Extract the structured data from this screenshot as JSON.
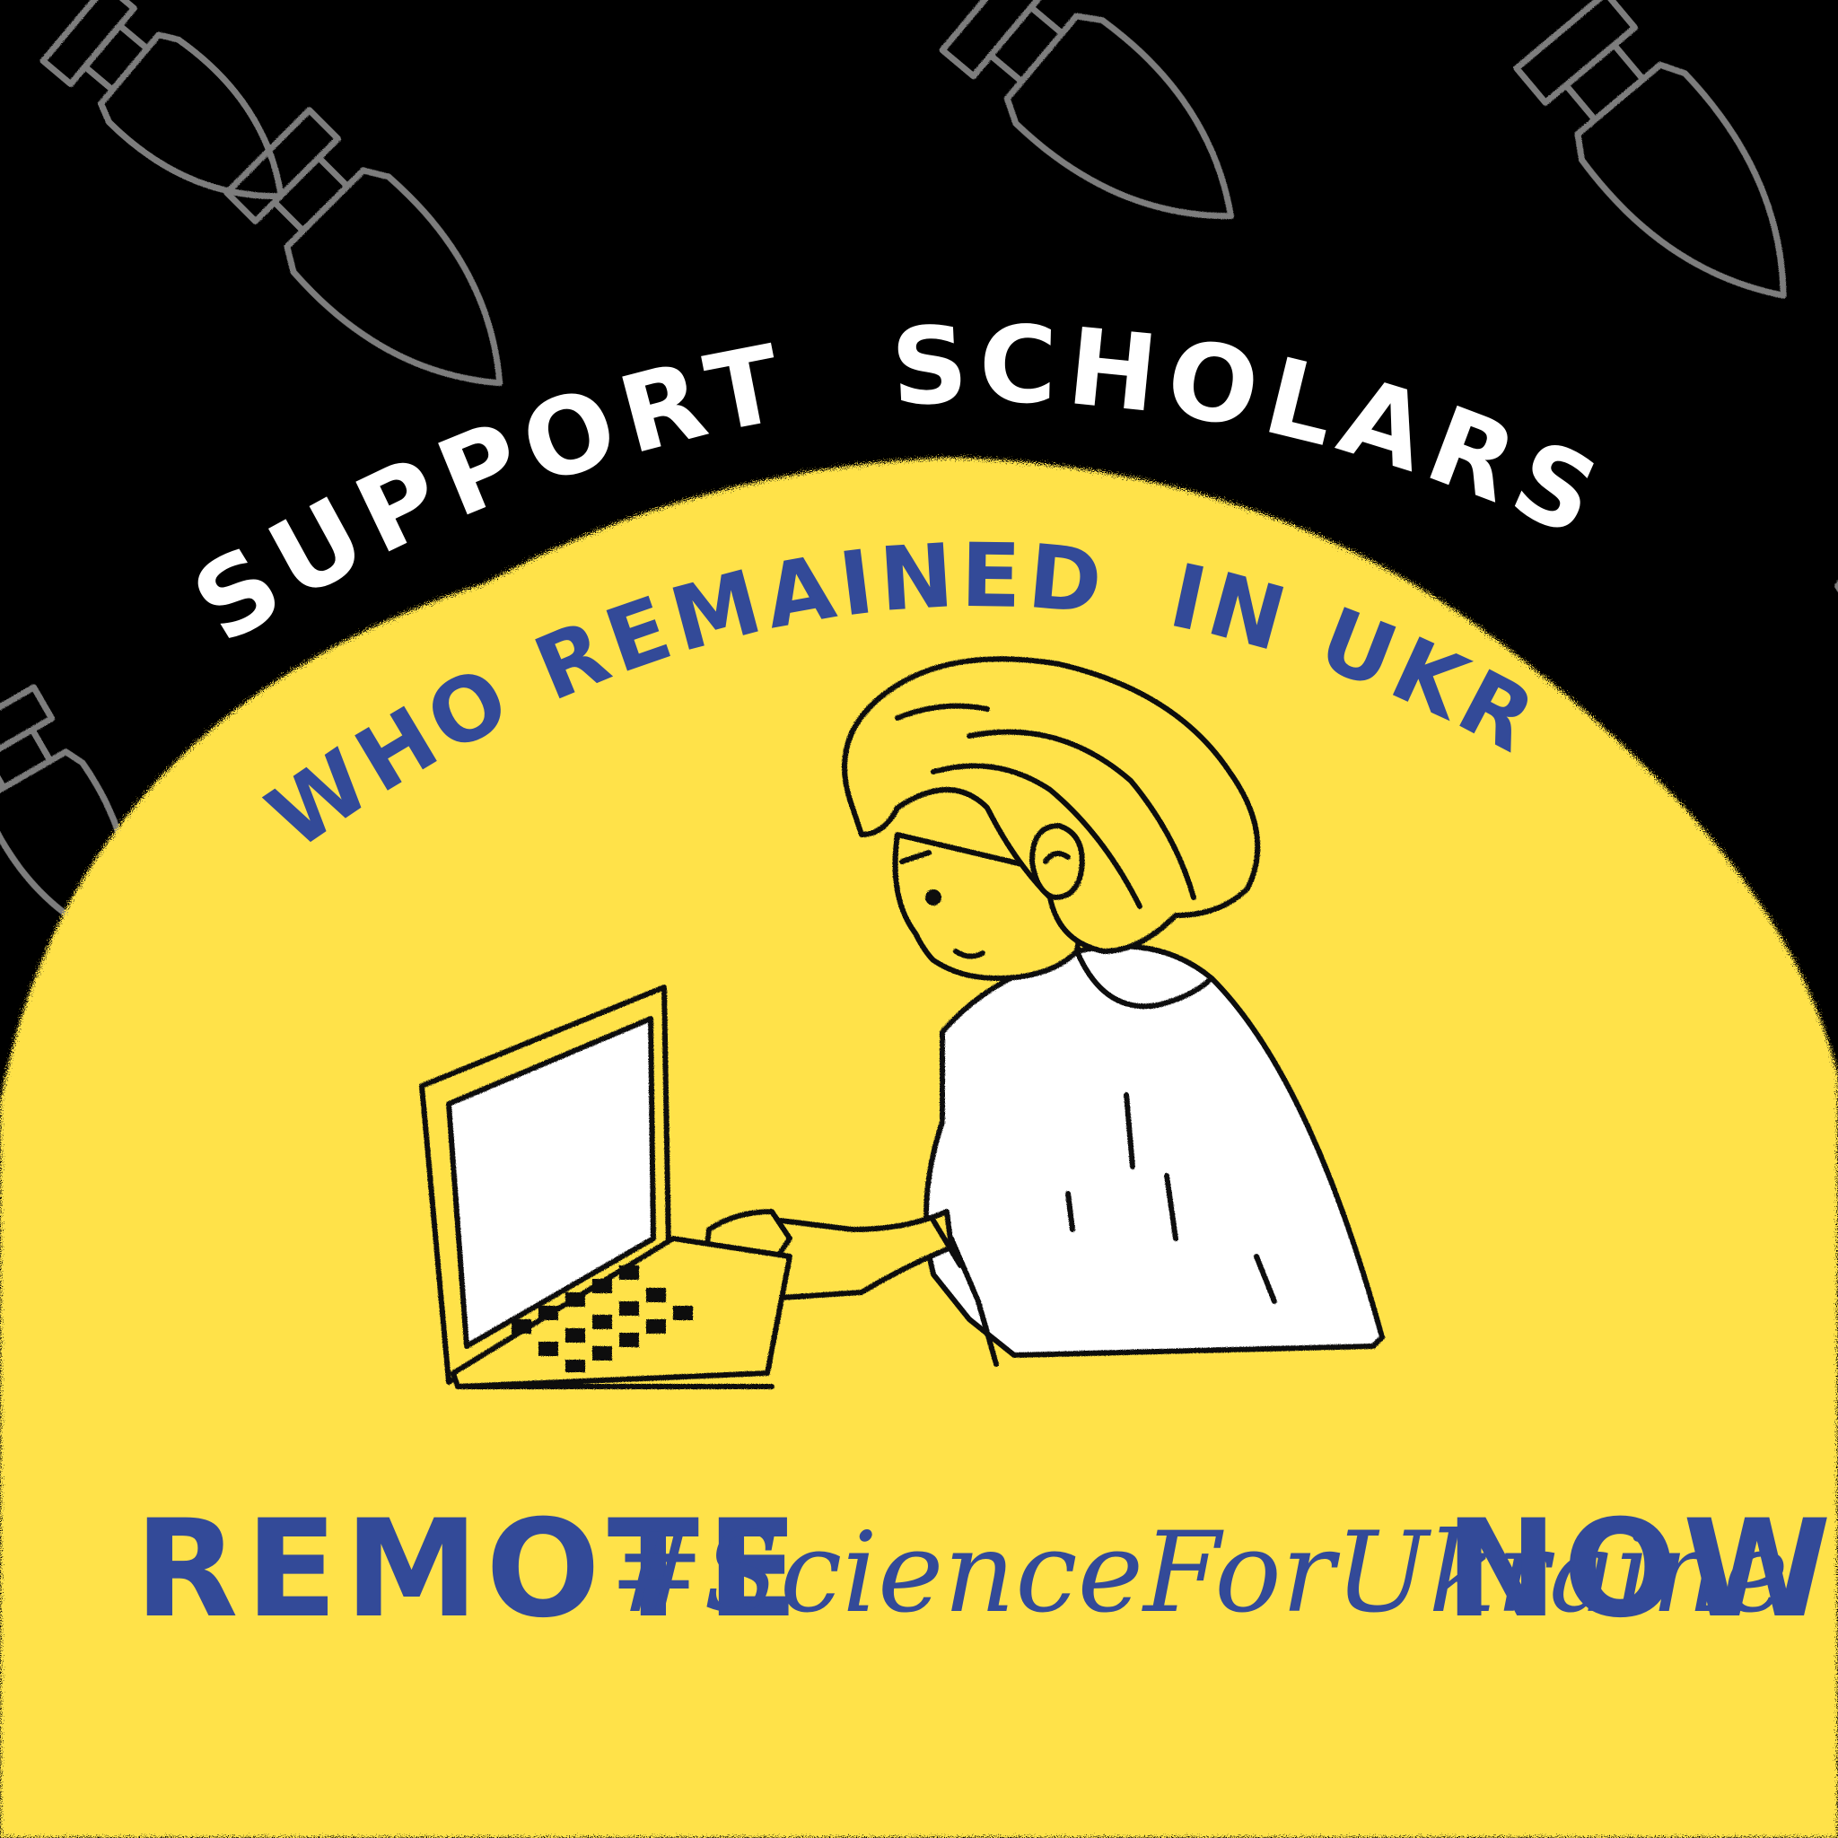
{
  "colors": {
    "background": "#000000",
    "glow": "#FFE24A",
    "heading_white": "#FFFFFF",
    "text_blue": "#334A98",
    "bomb_outline": "#7D7D7D",
    "ink": "#111111",
    "shirt": "#FFFFFF"
  },
  "headline": {
    "line1_word1": "SUPPORT",
    "line1_word2": "SCHOLARS",
    "line2_word1": "WHO REMAINED",
    "line2_word2": "IN UKRAINE"
  },
  "footer": {
    "word_remote": "REMOTE",
    "hashtag": "#ScienceForUkraine",
    "word_now": "NOW!"
  },
  "illustration": {
    "subject": "scholar-typing-on-laptop",
    "background_icons": [
      "bomb-icon",
      "bomb-icon",
      "bomb-icon",
      "bomb-icon",
      "bomb-icon",
      "bomb-icon"
    ]
  }
}
